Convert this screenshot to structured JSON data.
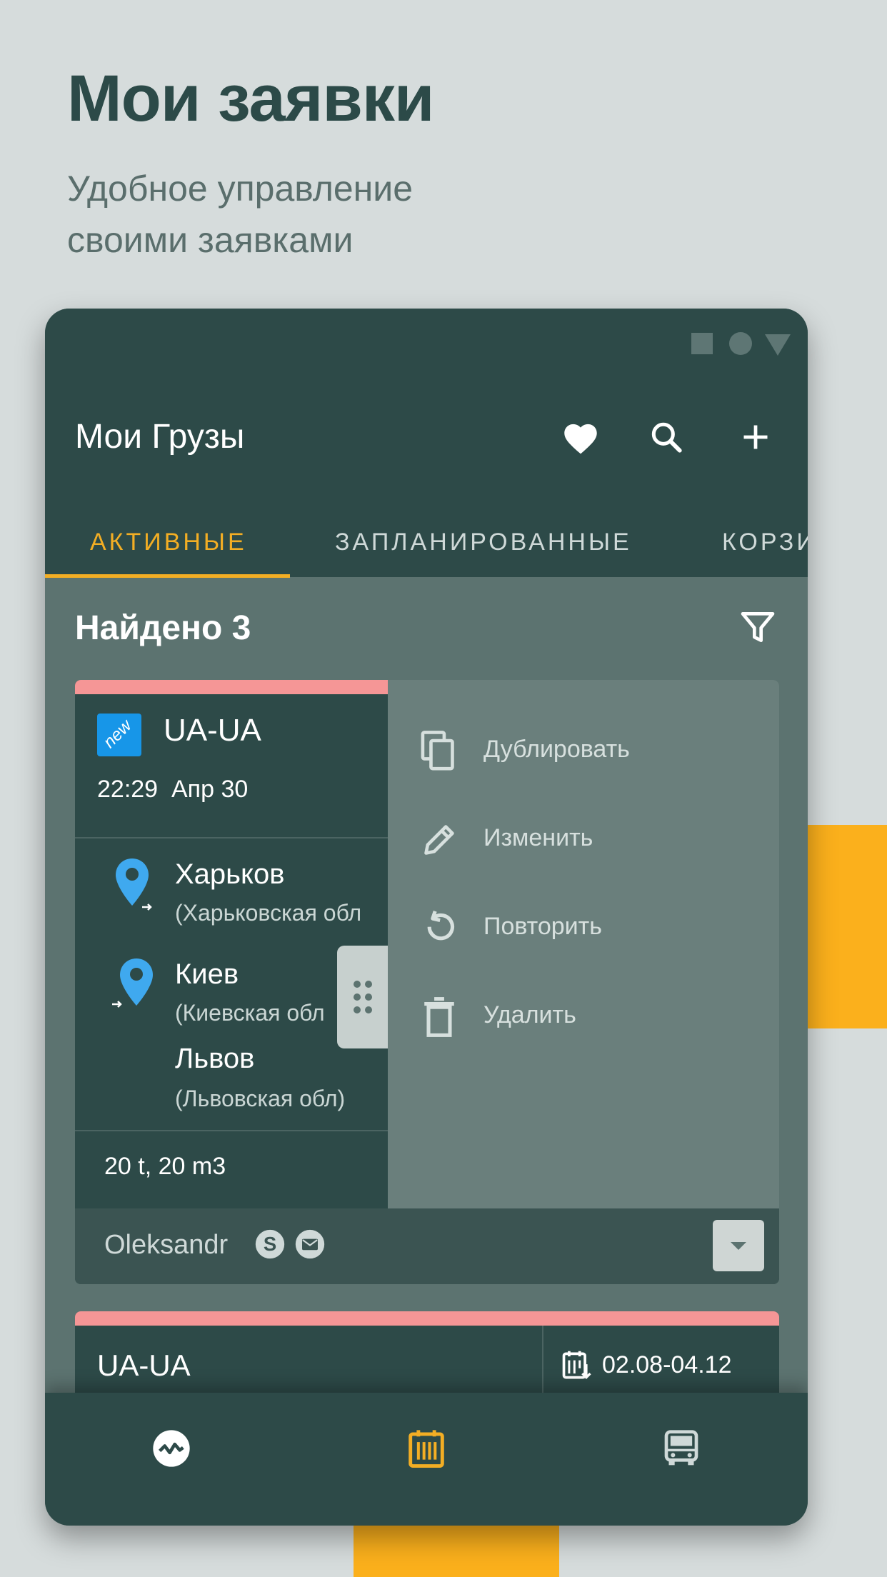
{
  "promo": {
    "title": "Мои заявки",
    "subtitle_line1": "Удобное управление",
    "subtitle_line2": "своими заявками"
  },
  "app": {
    "title": "Мои Грузы",
    "header_icons": [
      "heart-icon",
      "search-icon",
      "plus-icon"
    ],
    "tabs": [
      {
        "label": "АКТИВНЫЕ",
        "active": true
      },
      {
        "label": "ЗАПЛАНИРОВАННЫЕ",
        "active": false
      },
      {
        "label": "КОРЗИ",
        "active": false
      }
    ],
    "found_label": "Найдено 3"
  },
  "card1": {
    "badge": "new",
    "route": "UA-UA",
    "time": "22:29",
    "date": "Апр 30",
    "points": [
      {
        "city": "Харьков",
        "region": "(Харьковская обл"
      },
      {
        "city": "Киев",
        "region": "(Киевская обл"
      },
      {
        "city": "Львов",
        "region": "(Львовская обл)"
      }
    ],
    "cargo": "20 t, 20 m3",
    "owner": "Oleksandr",
    "menu": [
      {
        "label": "Дублировать",
        "icon": "copy-icon"
      },
      {
        "label": "Изменить",
        "icon": "pencil-icon"
      },
      {
        "label": "Повторить",
        "icon": "repeat-icon"
      },
      {
        "label": "Удалить",
        "icon": "trash-icon"
      }
    ]
  },
  "card2": {
    "route": "UA-UA",
    "dates": "02.08-04.12"
  },
  "bottom_nav": [
    {
      "icon": "activity-icon",
      "active": false
    },
    {
      "icon": "cargo-list-icon",
      "active": true
    },
    {
      "icon": "truck-icon",
      "active": false
    }
  ],
  "colors": {
    "accent": "#f3ae24",
    "header": "#2d4a48",
    "stripe": "#f59696",
    "pin": "#3fa9ef",
    "badge": "#1796e8"
  }
}
